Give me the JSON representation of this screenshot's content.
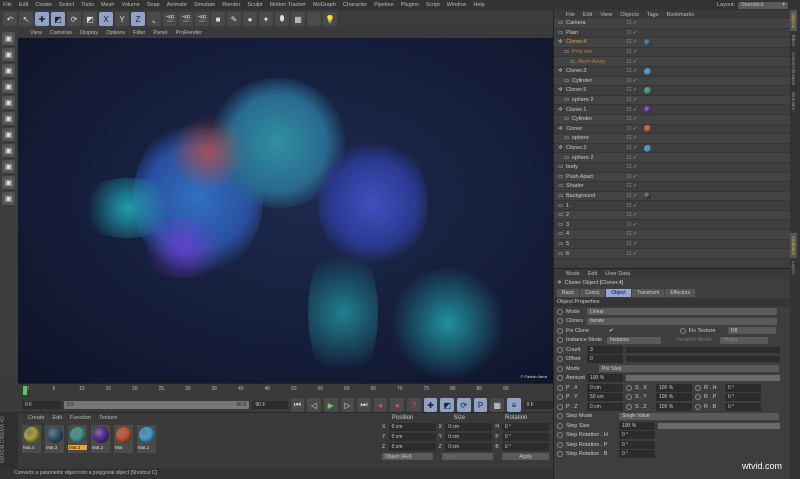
{
  "menu": [
    "File",
    "Edit",
    "Create",
    "Select",
    "Tools",
    "Mesh",
    "Volume",
    "Snap",
    "Animate",
    "Simulate",
    "Render",
    "Sculpt",
    "Motion Tracker",
    "MoGraph",
    "Character",
    "Pipeline",
    "Plugins",
    "Script",
    "Window",
    "Help"
  ],
  "layout": {
    "label": "Layout:",
    "value": "Standard"
  },
  "toolbar": [
    {
      "icon": "undo-icon",
      "g": "↶"
    },
    {
      "icon": "select-icon",
      "g": "↖"
    },
    {
      "icon": "move-icon",
      "g": "✚",
      "on": true
    },
    {
      "icon": "scale-icon",
      "g": "◩",
      "on": true
    },
    {
      "icon": "rotate-icon",
      "g": "⟳"
    },
    {
      "icon": "recent-tool-icon",
      "g": "◩"
    },
    {
      "icon": "x-axis-icon",
      "g": "X",
      "on": true
    },
    {
      "icon": "y-axis-icon",
      "g": "Y"
    },
    {
      "icon": "z-axis-icon",
      "g": "Z",
      "on": true
    },
    {
      "icon": "coordinate-system-icon",
      "g": "⌞"
    },
    {
      "icon": "render-view-icon",
      "g": "🎬"
    },
    {
      "icon": "render-picture-viewer-icon",
      "g": "🎬"
    },
    {
      "icon": "render-settings-icon",
      "g": "🎬"
    },
    {
      "icon": "cube-icon",
      "g": "■"
    },
    {
      "icon": "pen-icon",
      "g": "✎"
    },
    {
      "icon": "subdivision-icon",
      "g": "●"
    },
    {
      "icon": "array-icon",
      "g": "✦"
    },
    {
      "icon": "deformer-icon",
      "g": "⬮"
    },
    {
      "icon": "floor-icon",
      "g": "▦"
    },
    {
      "icon": "camera-icon",
      "g": "🎥"
    },
    {
      "icon": "light-icon",
      "g": "💡"
    }
  ],
  "left_tools": [
    "make-editable-icon",
    "model-mode-icon",
    "texture-mode-icon",
    "workplane-icon",
    "points-mode-icon",
    "edges-mode-icon",
    "polygons-mode-icon",
    "axis-mode-icon",
    "snap-icon",
    "locked-workplane-icon",
    "solo-icon"
  ],
  "viewport": {
    "menu": [
      "View",
      "Cameras",
      "Display",
      "Options",
      "Filter",
      "Panel",
      "ProRender"
    ],
    "credit": "© Fabian Ilarra"
  },
  "timeline": {
    "ticks": [
      "0",
      "5",
      "10",
      "15",
      "20",
      "25",
      "30",
      "35",
      "40",
      "45",
      "50",
      "55",
      "60",
      "65",
      "70",
      "75",
      "80",
      "85",
      "90"
    ],
    "current": "0 F",
    "start": "0 F",
    "range_start": "0 F",
    "range_end": "90 F",
    "end": "90 F",
    "right_field": "0 F"
  },
  "materials": {
    "menu": [
      "Create",
      "Edit",
      "Function",
      "Texture"
    ],
    "items": [
      {
        "name": "Mat.4",
        "color": "#a8a030"
      },
      {
        "name": "Mat.3",
        "color": "#2f5870"
      },
      {
        "name": "Mat.3",
        "color": "#3a9a90",
        "active": true
      },
      {
        "name": "Mat.2",
        "color": "#5a2aa0"
      },
      {
        "name": "Mat",
        "color": "#d0502a"
      },
      {
        "name": "Mat.1",
        "color": "#3aa0d8"
      }
    ]
  },
  "brand": "MAXON CINEMA 4D",
  "coords": {
    "headers": [
      "Position",
      "Size",
      "Rotation"
    ],
    "rows": [
      [
        "X",
        "0 cm",
        "X",
        "0 cm",
        "H",
        "0 °"
      ],
      [
        "Y",
        "0 cm",
        "Y",
        "0 cm",
        "P",
        "0 °"
      ],
      [
        "Z",
        "0 cm",
        "Z",
        "0 cm",
        "B",
        "0 °"
      ]
    ],
    "mode": "Object (Rel)",
    "size_mode": "Size",
    "apply": "Apply"
  },
  "status": "Converts a parametric object into a polygonal object [Shortcut C]",
  "objects": {
    "menu": [
      "File",
      "Edit",
      "View",
      "Objects",
      "Tags",
      "Bookmarks"
    ],
    "rows": [
      {
        "name": "Camera",
        "indent": 0
      },
      {
        "name": "Plain",
        "indent": 0
      },
      {
        "name": "Cloner.4",
        "indent": 0,
        "hl": true,
        "tag": "#2f5870"
      },
      {
        "name": "Poly net",
        "indent": 1,
        "hl2": true
      },
      {
        "name": "Atom Array",
        "indent": 2,
        "hl2": true
      },
      {
        "name": "Cloner.3",
        "indent": 0,
        "tag": "#3aa0d8"
      },
      {
        "name": "Cylinder",
        "indent": 1
      },
      {
        "name": "Cloner.5",
        "indent": 0,
        "tag": "#3a9a90"
      },
      {
        "name": "sphere 2",
        "indent": 1
      },
      {
        "name": "Cloner.1",
        "indent": 0,
        "tag": "#5a2aa0"
      },
      {
        "name": "Cylinder",
        "indent": 1
      },
      {
        "name": "Cloner",
        "indent": 0,
        "tag": "#d0502a"
      },
      {
        "name": "sphere",
        "indent": 1
      },
      {
        "name": "Cloner.2",
        "indent": 0,
        "tag": "#3aa0d8"
      },
      {
        "name": "sphere 2",
        "indent": 1
      },
      {
        "name": "body",
        "indent": 0
      },
      {
        "name": "Push Apart",
        "indent": 0
      },
      {
        "name": "Shader",
        "indent": 0
      },
      {
        "name": "Background",
        "indent": 0,
        "tag": "#2f3a48"
      },
      {
        "name": "1",
        "indent": 0
      },
      {
        "name": "2",
        "indent": 0
      },
      {
        "name": "3",
        "indent": 0
      },
      {
        "name": "4",
        "indent": 0
      },
      {
        "name": "5",
        "indent": 0
      },
      {
        "name": "6",
        "indent": 0
      }
    ]
  },
  "attributes": {
    "menu": [
      "Mode",
      "Edit",
      "User Data"
    ],
    "title": "Cloner Object [Cloner.4]",
    "tabs": [
      "Basic",
      "Coord.",
      "Object",
      "Transform",
      "Effectors"
    ],
    "active_tab": "Object",
    "section": "Object Properties",
    "mode_label": "Mode",
    "mode": "Linear",
    "clones_label": "Clones",
    "clones": "Iterate",
    "fix_clone": "Fix Clone",
    "fix_texture": "Fix Texture",
    "fix_texture_val": "Off",
    "instance_mode": "Instance Mode",
    "instance_val": "Instance",
    "viewport_mode": "Viewport Mode",
    "viewport_val": "Object",
    "count_label": "Count",
    "count": "3",
    "offset_label": "Offset",
    "offset": "0",
    "mode2_label": "Mode",
    "mode2": "Per Step",
    "amount_label": "Amount",
    "amount": "100 %",
    "prs": [
      [
        "P . X",
        "0 cm",
        "S . X",
        "100 %",
        "R . H",
        "0 °"
      ],
      [
        "P . Y",
        "50 cm",
        "S . Y",
        "100 %",
        "R . P",
        "0 °"
      ],
      [
        "P . Z",
        "0 cm",
        "S . Z",
        "100 %",
        "R . B",
        "0 °"
      ]
    ],
    "step_mode_label": "Step Mode",
    "step_mode": "Single Value",
    "step_size_label": "Step Size",
    "step_size": "100 %",
    "step_rot": [
      [
        "Step Rotation . H",
        "0 °"
      ],
      [
        "Step Rotation . P",
        "0 °"
      ],
      [
        "Step Rotation . B",
        "0 °"
      ]
    ]
  },
  "right_tabs": [
    "Objects",
    "Takes",
    "Content Browser",
    "Structure",
    "Attributes",
    "Layers"
  ],
  "watermark": "wtvid.com"
}
